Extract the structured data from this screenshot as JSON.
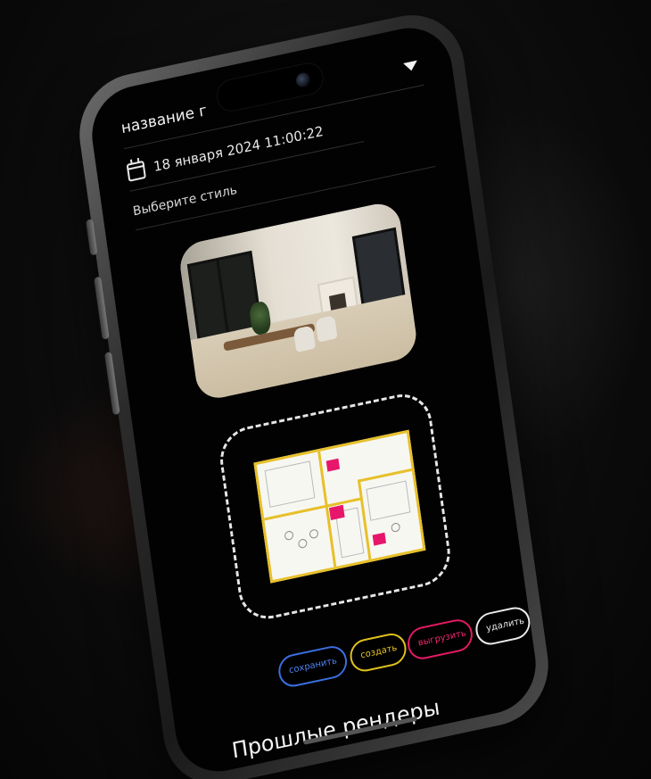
{
  "header": {
    "title": "название г",
    "dropdown_icon": "triangle-down-icon"
  },
  "date": {
    "icon": "calendar-icon",
    "value": "18 января 2024 11:00:22"
  },
  "style_select": {
    "label": "Выберите стиль"
  },
  "render_preview": {
    "description_icon": "interior-photo"
  },
  "upload": {
    "plan_icon": "floor-plan-image"
  },
  "actions": {
    "save_label": "сохранить",
    "create_label": "создать",
    "upload_label": "выгрузить",
    "delete_label": "удалить",
    "colors": {
      "save": "#3b6fe0",
      "create": "#e0c21d",
      "upload": "#e41a63",
      "delete": "#eaeaea"
    }
  },
  "past_renders": {
    "title": "Прошлые рендеры"
  }
}
